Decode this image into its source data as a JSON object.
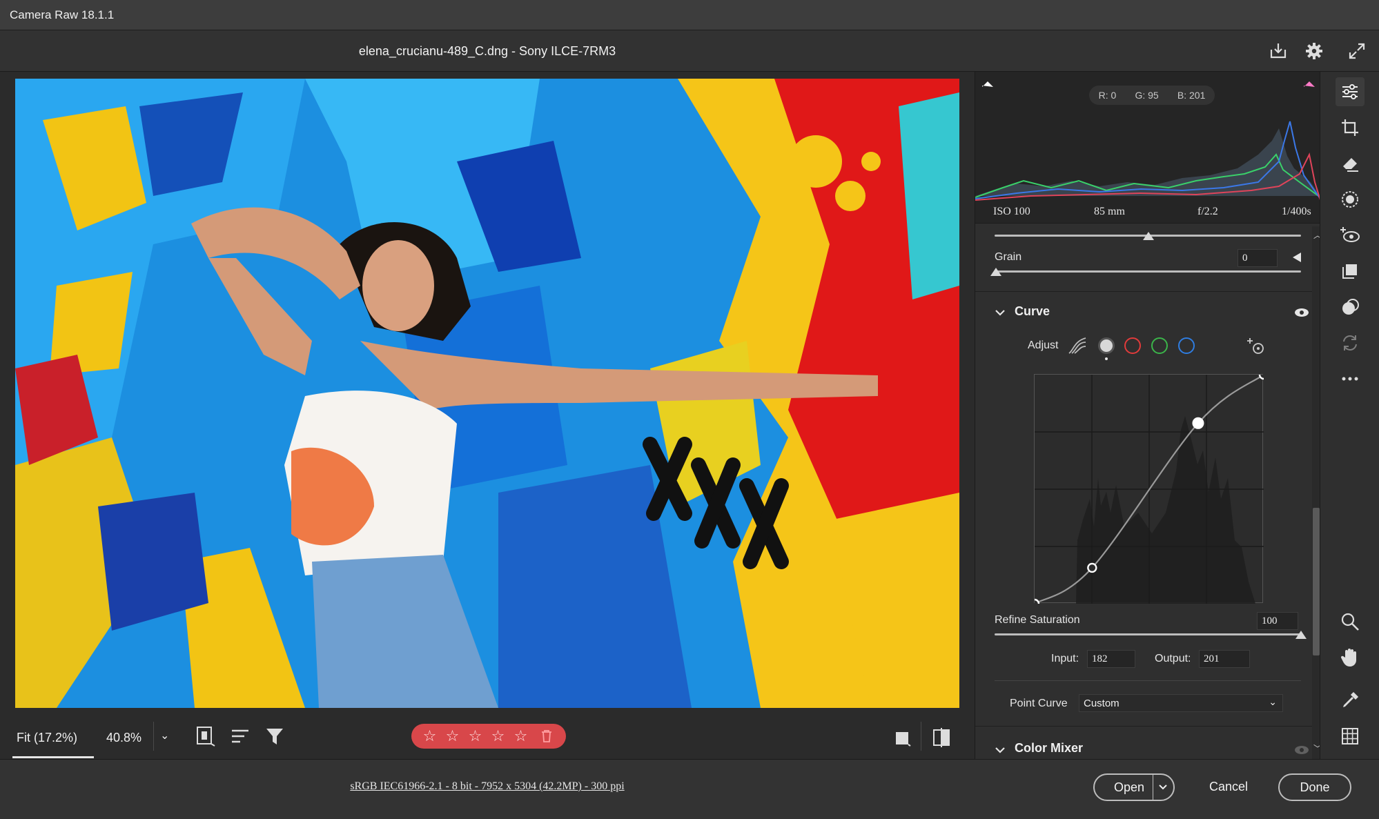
{
  "window": {
    "title": "Camera Raw 18.1.1"
  },
  "file_header": {
    "title": "elena_crucianu-489_C.dng  -  Sony ILCE-7RM3"
  },
  "header_icons": [
    "save-icon",
    "gear-icon",
    "fullscreen-icon"
  ],
  "histogram": {
    "readout": {
      "r": "R: 0",
      "g": "G: 95",
      "b": "B: 201"
    },
    "exif": {
      "iso": "ISO 100",
      "focal": "85 mm",
      "aperture": "f/2.2",
      "shutter": "1/400s"
    }
  },
  "effects": {
    "grain": {
      "label": "Grain",
      "value": "0"
    }
  },
  "curve": {
    "title": "Curve",
    "adjust_label": "Adjust",
    "refine_saturation": {
      "label": "Refine Saturation",
      "value": "100"
    },
    "input": {
      "label": "Input:",
      "value": "182"
    },
    "output": {
      "label": "Output:",
      "value": "201"
    },
    "point_curve": {
      "label": "Point Curve",
      "selected": "Custom"
    },
    "points": [
      [
        0,
        0
      ],
      [
        64,
        40
      ],
      [
        182,
        201
      ],
      [
        255,
        255
      ]
    ]
  },
  "color_mixer": {
    "title": "Color Mixer"
  },
  "viewer": {
    "zoom_fit": "Fit (17.2%)",
    "zoom_level": "40.8%",
    "stars": [
      "☆",
      "☆",
      "☆",
      "☆",
      "☆"
    ]
  },
  "bottom": {
    "workflow_link": "sRGB IEC61966-2.1 - 8 bit - 7952 x 5304 (42.2MP) - 300 ppi",
    "open_label": "Open",
    "cancel_label": "Cancel",
    "done_label": "Done"
  },
  "colors": {
    "red_dot": "#e23b3b",
    "green_dot": "#3bb54a",
    "blue_dot": "#2f7de1",
    "rating_pill": "#d8474a"
  },
  "tool_rail": [
    "edit-sliders-icon",
    "crop-icon",
    "eraser-icon",
    "masking-icon",
    "red-eye-icon",
    "presets-icon",
    "snapshots-icon",
    "sync-icon",
    "more-icon",
    "zoom-icon",
    "hand-icon",
    "color-sampler-icon",
    "grid-icon"
  ]
}
